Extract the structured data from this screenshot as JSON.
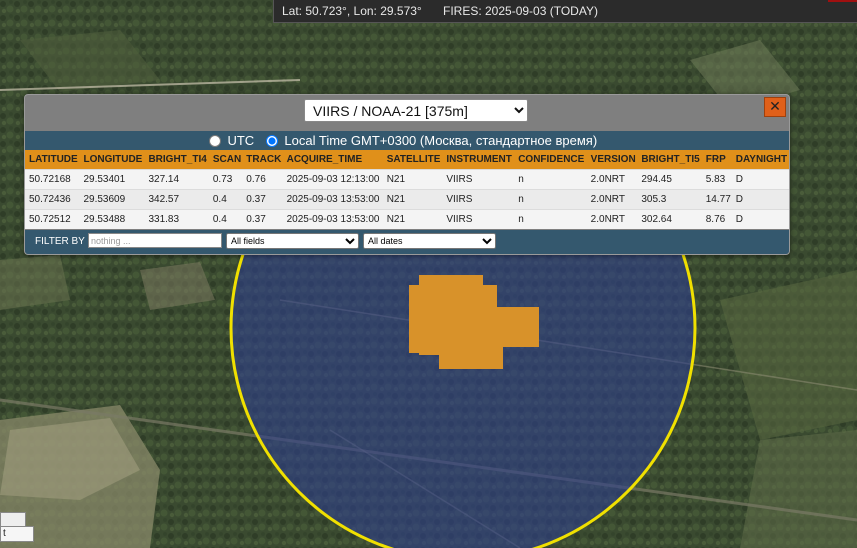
{
  "topbar": {
    "coords": "Lat: 50.723°, Lon: 29.573°",
    "fires": "FIRES: 2025-09-03 (TODAY)"
  },
  "popup": {
    "sensor_selected": "VIIRS / NOAA-21 [375m]",
    "close_label": "✕",
    "time_options": {
      "utc": "UTC",
      "local": "Local Time GMT+0300 (Москва, стандартное время)",
      "selected": "local"
    },
    "columns": [
      "LATITUDE",
      "LONGITUDE",
      "BRIGHT_TI4",
      "SCAN",
      "TRACK",
      "ACQUIRE_TIME",
      "SATELLITE",
      "INSTRUMENT",
      "CONFIDENCE",
      "VERSION",
      "BRIGHT_TI5",
      "FRP",
      "DAYNIGHT"
    ],
    "rows": [
      [
        "50.72168",
        "29.53401",
        "327.14",
        "0.73",
        "0.76",
        "2025-09-03 12:13:00",
        "N21",
        "VIIRS",
        "n",
        "2.0NRT",
        "294.45",
        "5.83",
        "D"
      ],
      [
        "50.72436",
        "29.53609",
        "342.57",
        "0.4",
        "0.37",
        "2025-09-03 13:53:00",
        "N21",
        "VIIRS",
        "n",
        "2.0NRT",
        "305.3",
        "14.77",
        "D"
      ],
      [
        "50.72512",
        "29.53488",
        "331.83",
        "0.4",
        "0.37",
        "2025-09-03 13:53:00",
        "N21",
        "VIIRS",
        "n",
        "2.0NRT",
        "302.64",
        "8.76",
        "D"
      ]
    ],
    "filter": {
      "label": "FILTER BY",
      "placeholder": "nothing ...",
      "fields_selected": "All fields",
      "dates_selected": "All dates"
    }
  },
  "map": {
    "corner_label": "t"
  },
  "colors": {
    "fire_pixel": "#d8922a",
    "radius_circle": "#f0e000",
    "radius_fill": "#2f3f8a",
    "header_orange": "#e0901a",
    "panel_blue": "#34586e"
  },
  "icons": {
    "close": "close-icon",
    "radio": "radio-icon",
    "dropdown": "chevron-down-icon"
  }
}
